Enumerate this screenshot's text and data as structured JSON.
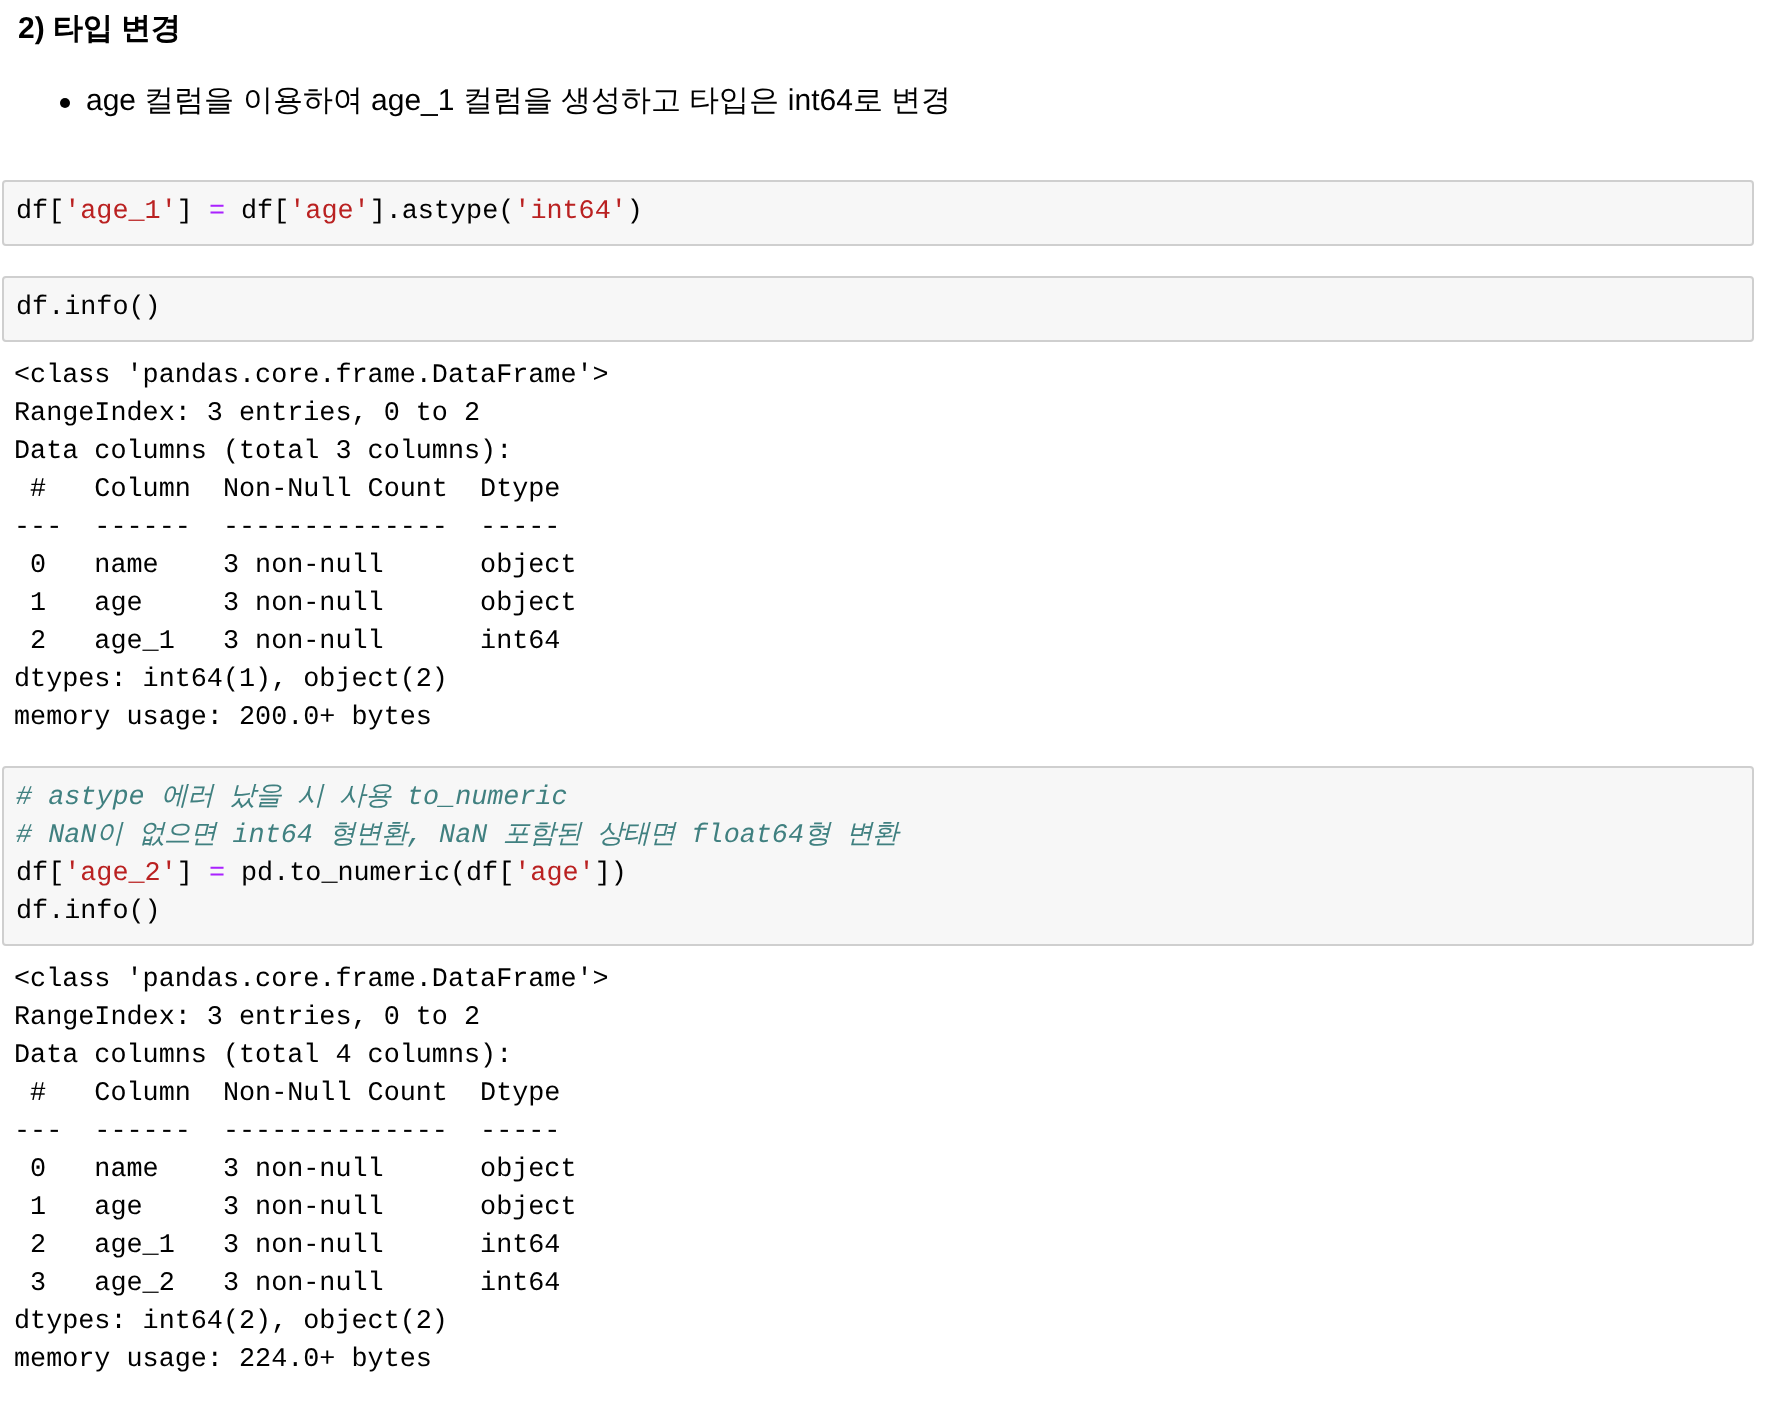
{
  "heading": "2) 타입 변경",
  "bullets": [
    "age 컬럼을 이용하여 age_1 컬럼을 생성하고 타입은 int64로 변경"
  ],
  "cells": [
    {
      "kind": "code",
      "lines": [
        [
          {
            "kind": "plain",
            "text": "df["
          },
          {
            "kind": "string",
            "text": "'age_1'"
          },
          {
            "kind": "plain",
            "text": "] "
          },
          {
            "kind": "operator",
            "text": "="
          },
          {
            "kind": "plain",
            "text": " df["
          },
          {
            "kind": "string",
            "text": "'age'"
          },
          {
            "kind": "plain",
            "text": "].astype("
          },
          {
            "kind": "string",
            "text": "'int64'"
          },
          {
            "kind": "plain",
            "text": ")"
          }
        ]
      ]
    },
    {
      "kind": "code",
      "lines": [
        [
          {
            "kind": "plain",
            "text": "df.info()"
          }
        ]
      ]
    },
    {
      "kind": "output",
      "lines": [
        "<class 'pandas.core.frame.DataFrame'>",
        "RangeIndex: 3 entries, 0 to 2",
        "Data columns (total 3 columns):",
        " #   Column  Non-Null Count  Dtype ",
        "---  ------  --------------  ----- ",
        " 0   name    3 non-null      object",
        " 1   age     3 non-null      object",
        " 2   age_1   3 non-null      int64 ",
        "dtypes: int64(1), object(2)",
        "memory usage: 200.0+ bytes"
      ]
    },
    {
      "kind": "code",
      "lines": [
        [
          {
            "kind": "comment",
            "text": "# astype 에러 났을 시 사용 to_numeric"
          }
        ],
        [
          {
            "kind": "comment",
            "text": "# NaN이 없으면 int64 형변환, NaN 포함된 상태면 float64형 변환"
          }
        ],
        [
          {
            "kind": "plain",
            "text": "df["
          },
          {
            "kind": "string",
            "text": "'age_2'"
          },
          {
            "kind": "plain",
            "text": "] "
          },
          {
            "kind": "operator",
            "text": "="
          },
          {
            "kind": "plain",
            "text": " pd.to_numeric(df["
          },
          {
            "kind": "string",
            "text": "'age'"
          },
          {
            "kind": "plain",
            "text": "])"
          }
        ],
        [
          {
            "kind": "plain",
            "text": "df.info()"
          }
        ]
      ]
    },
    {
      "kind": "output",
      "lines": [
        "<class 'pandas.core.frame.DataFrame'>",
        "RangeIndex: 3 entries, 0 to 2",
        "Data columns (total 4 columns):",
        " #   Column  Non-Null Count  Dtype ",
        "---  ------  --------------  ----- ",
        " 0   name    3 non-null      object",
        " 1   age     3 non-null      object",
        " 2   age_1   3 non-null      int64 ",
        " 3   age_2   3 non-null      int64 ",
        "dtypes: int64(2), object(2)",
        "memory usage: 224.0+ bytes"
      ]
    }
  ]
}
